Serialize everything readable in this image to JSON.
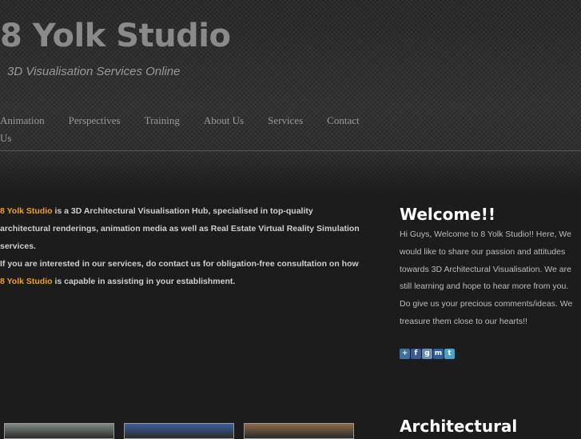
{
  "header": {
    "title": "8 Yolk Studio",
    "tagline": "3D Visualisation Services Online"
  },
  "nav": {
    "items": [
      {
        "label": "Animation"
      },
      {
        "label": "Perspectives"
      },
      {
        "label": "Training"
      },
      {
        "label": "About Us"
      },
      {
        "label": "Services"
      },
      {
        "label": "Contact"
      },
      {
        "label": "Us"
      }
    ]
  },
  "intro": {
    "brand": "8 Yolk Studio",
    "line1_rest": " is a 3D Architectural Visualisation Hub, specialised in top-quality architectural renderings, animation media as well as Real Estate Virtual Reality Simulation services.",
    "line2_start": "If you are interested in our services, do contact us for obligation-free consultation on how ",
    "brand2": "8 Yolk Studio",
    "line2_rest": " is capable in assisting in your establishment."
  },
  "welcome": {
    "title": "Welcome!!",
    "body": "Hi Guys, Welcome to 8 Yolk Studio!! Here, We would like to share our passion and attitudes towards 3D Architectural Visualisation. We are still learning and hope to hear more from you. Do give us your precious comments/ideas. We treasure them close to our hearts!!"
  },
  "social": {
    "icons": [
      {
        "name": "share-icon",
        "glyph": "+",
        "color": "#3b6fa8"
      },
      {
        "name": "facebook-icon",
        "glyph": "f",
        "color": "#3b5998"
      },
      {
        "name": "google-icon",
        "glyph": "g",
        "color": "#6a8fb5"
      },
      {
        "name": "myspace-icon",
        "glyph": "m",
        "color": "#2f5fa0"
      },
      {
        "name": "twitter-icon",
        "glyph": "t",
        "color": "#4aa3c8"
      }
    ]
  },
  "gallery": {
    "thumbs": [
      {
        "name": "thumb-aerial",
        "color": "#7f8b84"
      },
      {
        "name": "thumb-sky",
        "color": "#3d5f9e"
      },
      {
        "name": "thumb-interior",
        "color": "#8e6a45"
      }
    ]
  },
  "section2": {
    "title": "Architectural"
  },
  "colors": {
    "accent": "#f0a020",
    "background": "#1c1c1c"
  }
}
